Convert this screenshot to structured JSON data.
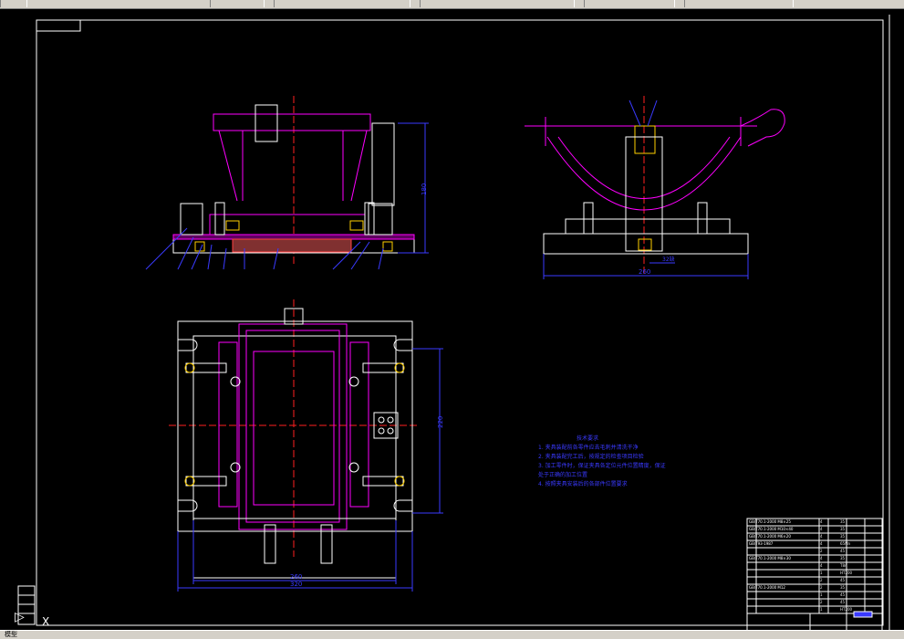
{
  "toolbar": {
    "items": [
      "",
      "",
      "",
      "",
      "",
      ""
    ]
  },
  "drawing": {
    "front_view_dim_height": "180",
    "side_view_dim_top": "32缺",
    "side_view_dim_bottom": "260",
    "top_view_dim_right": "220",
    "top_view_dim_width_inner": "260",
    "top_view_dim_width_outer": "320"
  },
  "tech_notes": {
    "title": "技术要求",
    "lines": [
      "1. 夹具装配前各零件应去毛刺并清洗干净",
      "2. 夹具装配完工后，按规定的检查项目检验",
      "3. 加工零件时，保证夹具各定位元件位置精度，保证",
      "   处于正确的加工位置",
      "4. 按照夹具安装后的各部件位置要求"
    ]
  },
  "bom": {
    "rows": [
      {
        "name": "GB/T70.1-2000 M8×25",
        "qty": "4",
        "mat": "35"
      },
      {
        "name": "GB/T70.1-2000 M10×40",
        "qty": "4",
        "mat": "35"
      },
      {
        "name": "GB/T70.1-2000 M6×20",
        "qty": "4",
        "mat": "35"
      },
      {
        "name": "GB/T93-1987",
        "qty": "4",
        "mat": "65Mn"
      },
      {
        "name": "",
        "qty": "2",
        "mat": "45"
      },
      {
        "name": "GB/T70.1-2000 M8×30",
        "qty": "4",
        "mat": "35"
      },
      {
        "name": "",
        "qty": "4",
        "mat": "T8A"
      },
      {
        "name": "",
        "qty": "1",
        "mat": "HT200"
      },
      {
        "name": "",
        "qty": "2",
        "mat": "45"
      },
      {
        "name": "GB/T70.1-2000 M12",
        "qty": "2",
        "mat": "35"
      },
      {
        "name": "",
        "qty": "1",
        "mat": "45"
      },
      {
        "name": "",
        "qty": "2",
        "mat": "45"
      },
      {
        "name": "",
        "qty": "1",
        "mat": "HT200"
      }
    ],
    "title_block_label": "",
    "title_block_right": ""
  },
  "statusbar": {
    "tab": "模型"
  },
  "colors": {
    "magenta": "#ff00ff",
    "white": "#ffffff",
    "blue": "#3a3aff",
    "red": "#ff2020",
    "yellow": "#ffd000"
  }
}
